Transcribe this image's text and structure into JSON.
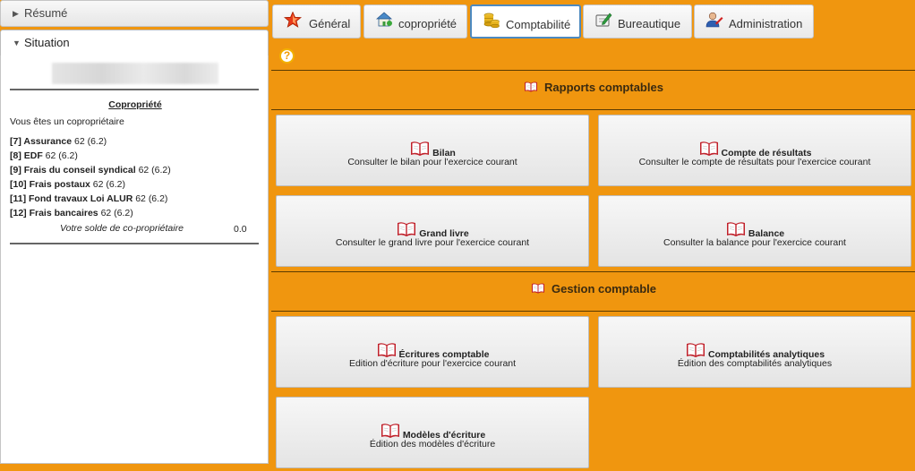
{
  "left_panel": {
    "resume_label": "Résumé",
    "situation_label": "Situation",
    "copro_title": "Copropriété",
    "copro_status": "Vous êtes un copropriétaire",
    "charges": [
      {
        "code": "[7] Assurance",
        "value": "62 (6.2)"
      },
      {
        "code": "[8] EDF",
        "value": "62 (6.2)"
      },
      {
        "code": "[9] Frais du conseil syndical",
        "value": "62 (6.2)"
      },
      {
        "code": "[10] Frais postaux",
        "value": "62 (6.2)"
      },
      {
        "code": "[11] Fond travaux Loi ALUR",
        "value": "62 (6.2)"
      },
      {
        "code": "[12] Frais bancaires",
        "value": "62 (6.2)"
      }
    ],
    "solde_label": "Votre solde de co-propriétaire",
    "solde_value": "0.0"
  },
  "tabs": [
    {
      "label": "Général",
      "icon": "star-icon"
    },
    {
      "label": "copropriété",
      "icon": "house-icon"
    },
    {
      "label": "Comptabilité",
      "icon": "coins-icon",
      "active": true
    },
    {
      "label": "Bureautique",
      "icon": "edit-icon"
    },
    {
      "label": "Administration",
      "icon": "admin-user-icon"
    }
  ],
  "help_glyph": "?",
  "sections": [
    {
      "title": "Rapports comptables",
      "cards": [
        {
          "title": "Bilan",
          "desc": "Consulter le bilan pour l'exercice courant"
        },
        {
          "title": "Compte de résultats",
          "desc": "Consulter le compte de résultats pour l'exercice courant"
        },
        {
          "title": "Grand livre",
          "desc": "Consulter le grand livre pour l'exercice courant"
        },
        {
          "title": "Balance",
          "desc": "Consulter la balance pour l'exercice courant"
        }
      ]
    },
    {
      "title": "Gestion comptable",
      "cards": [
        {
          "title": "Écritures comptable",
          "desc": "Edition d'écriture pour l'exercice courant"
        },
        {
          "title": "Comptabilités analytiques",
          "desc": "Édition des comptabilités analytiques"
        },
        {
          "title": "Modèles d'écriture",
          "desc": "Édition des modèles d'écriture"
        }
      ]
    }
  ],
  "colors": {
    "background": "#f0960f",
    "active_tab_border": "#4d8ac0",
    "book_icon": "#c0202a"
  }
}
